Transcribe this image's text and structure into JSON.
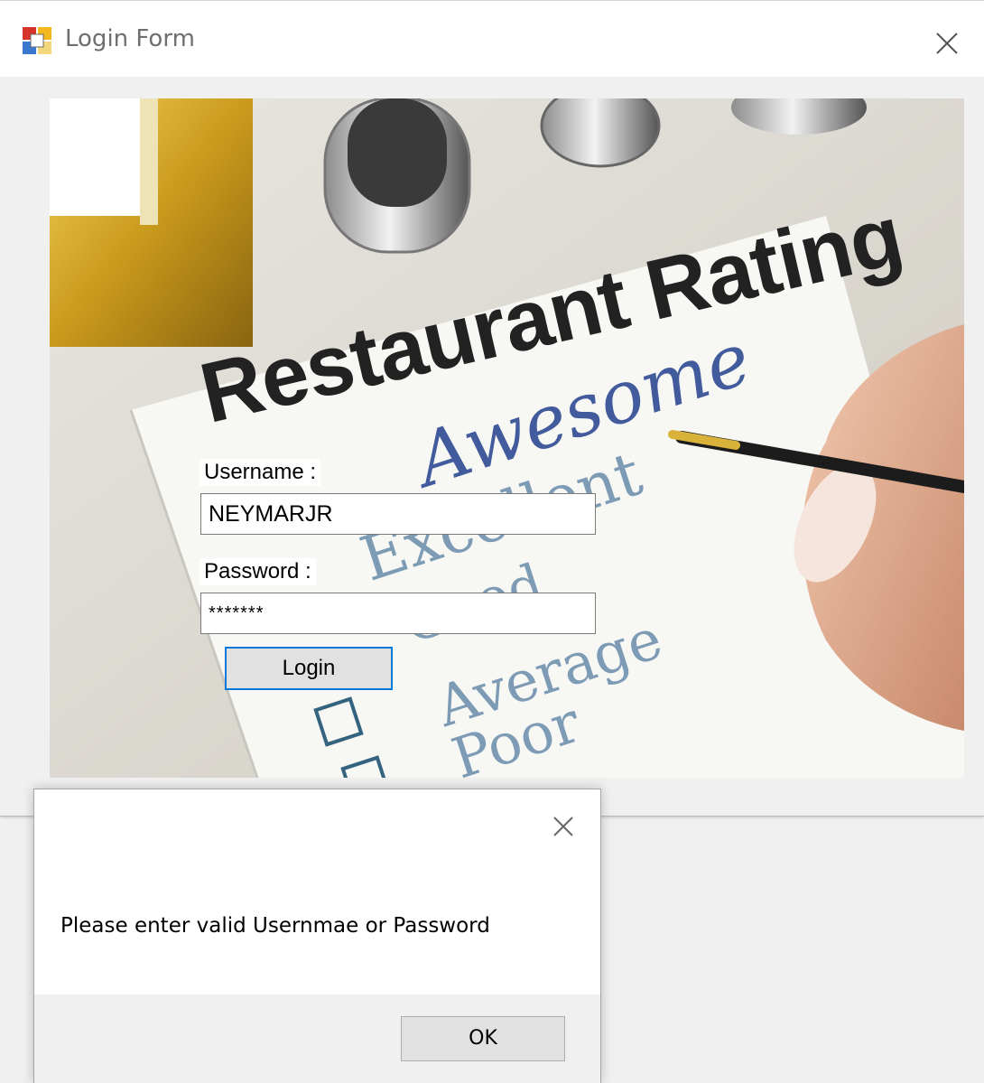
{
  "window": {
    "title": "Login Form",
    "icon": "winforms-app-icon",
    "close_icon": "close-icon"
  },
  "picture": {
    "heading": "Restaurant Rating",
    "script_word": "Awesome",
    "options": [
      "Excellent",
      "Good",
      "Average",
      "Poor"
    ]
  },
  "form": {
    "username_label": "Username :",
    "username_value": "NEYMARJR",
    "password_label": "Password :",
    "password_value": "*******",
    "login_button": "Login"
  },
  "messagebox": {
    "text": "Please enter valid Usernmae or Password",
    "ok_button": "OK",
    "close_icon": "close-icon"
  },
  "colors": {
    "focus_border": "#0078d7",
    "button_face": "#e1e1e1",
    "window_bg": "#f0f0f0"
  }
}
